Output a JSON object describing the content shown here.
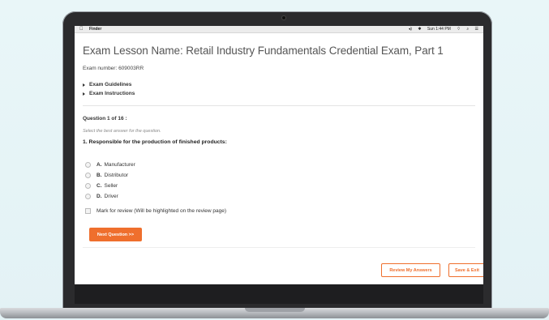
{
  "menubar": {
    "app": "Finder",
    "status": [
      "◂)",
      "✱",
      "Sun 1:44 PM",
      "⌔",
      "⌕",
      "☰"
    ]
  },
  "exam": {
    "title": "Exam Lesson Name: Retail Industry Fundamentals Credential Exam, Part 1",
    "number": "Exam number: 609003RR",
    "sections": [
      "Exam Guidelines",
      "Exam Instructions"
    ]
  },
  "question": {
    "counter": "Question 1 of 16 :",
    "instruction": "Select the best answer for the question.",
    "text": "1.   Responsible for the production of finished products:",
    "options": [
      {
        "letter": "A.",
        "label": "Manufacturer"
      },
      {
        "letter": "B.",
        "label": "Distributor"
      },
      {
        "letter": "C.",
        "label": "Seller"
      },
      {
        "letter": "D.",
        "label": "Driver"
      }
    ],
    "mark_review": "Mark for review (Will be highlighted on the review page)"
  },
  "buttons": {
    "next": "Next Question >>",
    "review": "Review My Answers",
    "save": "Save & Exit"
  },
  "colors": {
    "accent": "#ef6f2d",
    "background": "#e6f4f6"
  }
}
